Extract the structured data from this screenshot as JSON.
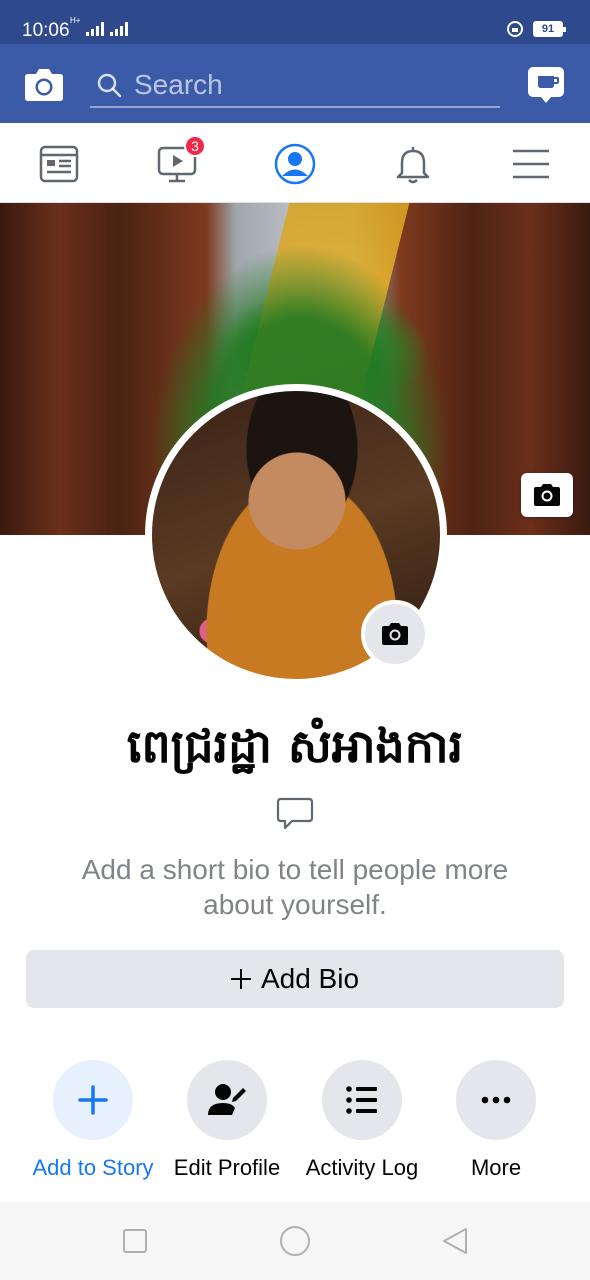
{
  "status_bar": {
    "time": "10:06",
    "network": "H+",
    "battery": "91"
  },
  "header": {
    "search_placeholder": "Search"
  },
  "nav": {
    "watch_badge": "3",
    "active_tab": "profile"
  },
  "profile": {
    "name": "ពេជ្ររដ្ឋា សំអាងការ",
    "bio_hint": "Add a short bio to tell people more about yourself.",
    "add_bio_label": "Add Bio"
  },
  "actions": [
    {
      "label": "Add to Story",
      "icon": "plus-icon"
    },
    {
      "label": "Edit Profile",
      "icon": "edit-profile-icon"
    },
    {
      "label": "Activity Log",
      "icon": "list-icon"
    },
    {
      "label": "More",
      "icon": "more-icon"
    }
  ],
  "colors": {
    "brand": "#3b5ba9",
    "accent": "#1877f2",
    "badge": "#f02849"
  }
}
